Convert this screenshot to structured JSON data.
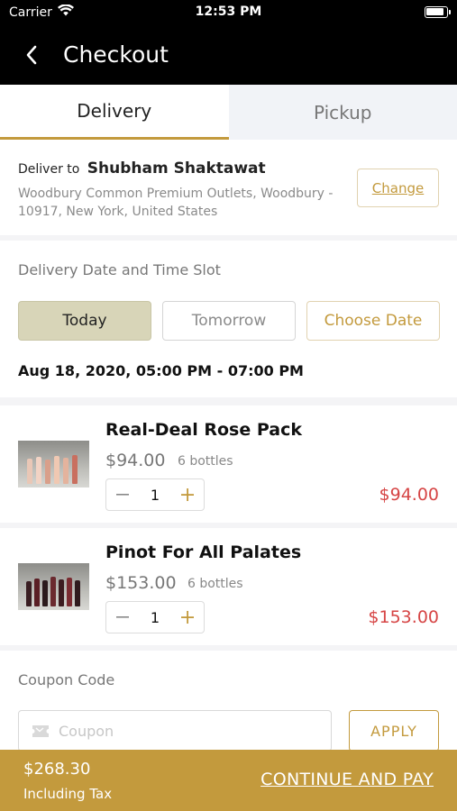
{
  "status_bar": {
    "carrier": "Carrier",
    "time": "12:53 PM"
  },
  "header": {
    "title": "Checkout"
  },
  "tabs": [
    {
      "label": "Delivery",
      "active": true
    },
    {
      "label": "Pickup",
      "active": false
    }
  ],
  "address": {
    "prefix": "Deliver to",
    "name": "Shubham Shaktawat",
    "line": "Woodbury Common Premium Outlets, Woodbury - 10917, New York, United States",
    "change_label": "Change"
  },
  "delivery_slot": {
    "label": "Delivery Date and Time Slot",
    "options": [
      "Today",
      "Tomorrow",
      "Choose Date"
    ],
    "selected_option": "Today",
    "selected_text": "Aug 18, 2020, 05:00 PM - 07:00 PM"
  },
  "cart": [
    {
      "name": "Real-Deal Rose Pack",
      "price": "$94.00",
      "unit": "6 bottles",
      "quantity": "1",
      "total": "$94.00"
    },
    {
      "name": "Pinot For All Palates",
      "price": "$153.00",
      "unit": "6 bottles",
      "quantity": "1",
      "total": "$153.00"
    }
  ],
  "coupon": {
    "label": "Coupon Code",
    "placeholder": "Coupon",
    "apply_label": "APPLY"
  },
  "footer": {
    "amount": "$268.30",
    "tax_note": "Including Tax",
    "cta": "CONTINUE AND PAY"
  },
  "colors": {
    "accent": "#c39a3d",
    "price_red": "#d64545",
    "selected_slot": "#d8d5b8",
    "header_bg": "#000000"
  }
}
